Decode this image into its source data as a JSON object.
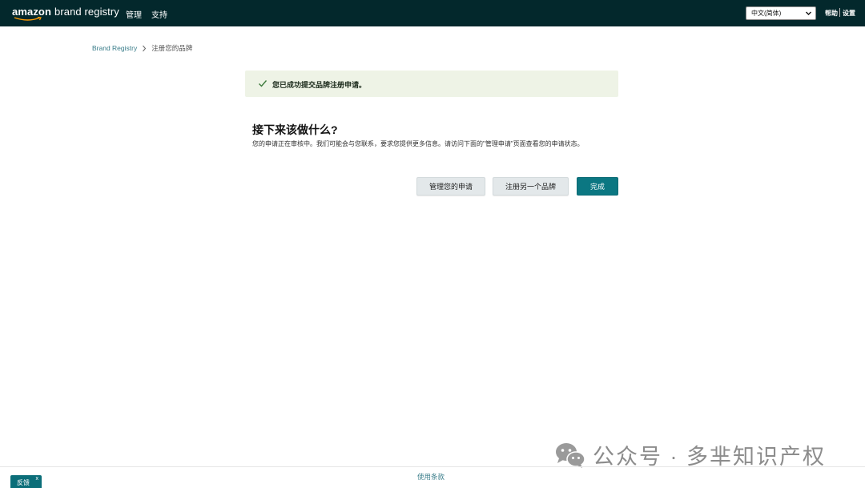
{
  "header": {
    "logo_amazon": "amazon",
    "logo_product": "brand registry",
    "nav": {
      "manage": "管理",
      "support": "支持"
    },
    "language_selected": "中文(简体)",
    "help": "帮助",
    "settings": "设置"
  },
  "breadcrumb": {
    "root": "Brand Registry",
    "current": "注册您的品牌"
  },
  "alert": {
    "icon": "check-icon",
    "message": "您已成功提交品牌注册申请。"
  },
  "next_steps": {
    "title": "接下来该做什么?",
    "description": "您的申请正在审核中。我们可能会与您联系，要求您提供更多信息。请访问下面的\"管理申请\"页面查看您的申请状态。"
  },
  "buttons": {
    "manage": "管理您的申请",
    "register_another": "注册另一个品牌",
    "done": "完成"
  },
  "watermark": {
    "text": "公众号 · 多芈知识产权"
  },
  "footer": {
    "terms": "使用条款",
    "feedback": "反馈",
    "feedback_close": "x"
  },
  "colors": {
    "topbar": "#03282c",
    "primary_button": "#0b7782",
    "alert_bg": "#eef3e6",
    "link": "#3a7d8a"
  }
}
